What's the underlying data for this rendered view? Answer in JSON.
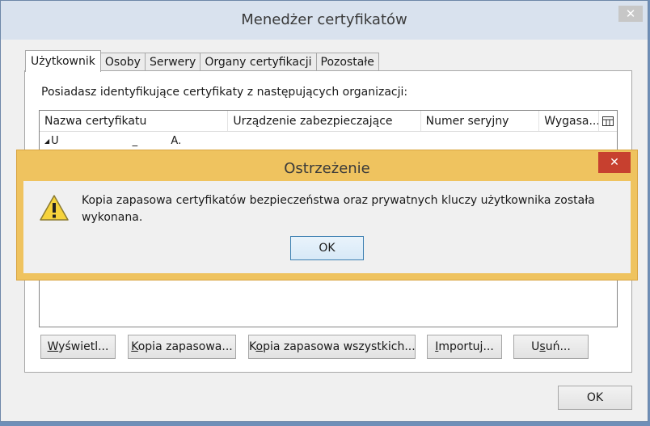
{
  "window": {
    "title": "Menedżer certyfikatów",
    "close_glyph": "✕"
  },
  "tabs": [
    {
      "label": "Użytkownik",
      "active": true
    },
    {
      "label": "Osoby",
      "active": false
    },
    {
      "label": "Serwery",
      "active": false
    },
    {
      "label": "Organy certyfikacji",
      "active": false
    },
    {
      "label": "Pozostałe",
      "active": false
    }
  ],
  "panel": {
    "description": "Posiadasz identyfikujące certyfikaty z następujących organizacji:"
  },
  "table": {
    "columns": [
      "Nazwa certyfikatu",
      "Urządzenie zabezpieczające",
      "Numer seryjny",
      "Wygasa..."
    ],
    "rows": [
      {
        "name": "U                      _          A."
      }
    ]
  },
  "buttons": {
    "view": {
      "key": "W",
      "rest": "yświetl..."
    },
    "backup": {
      "key": "K",
      "rest": "opia zapasowa..."
    },
    "backup_all_pre": "K",
    "backup_all_key": "o",
    "backup_all_rest": "pia zapasowa wszystkich...",
    "import": {
      "key": "I",
      "rest": "mportuj..."
    },
    "delete_pre": "U",
    "delete_key": "s",
    "delete_rest": "uń...",
    "ok": "OK"
  },
  "alert": {
    "title": "Ostrzeżenie",
    "close_glyph": "✕",
    "message": "Kopia zapasowa certyfikatów bezpieczeństwa oraz prywatnych kluczy użytkownika została wykonana.",
    "ok": "OK"
  },
  "colors": {
    "alert_frame": "#efc35f",
    "alert_close": "#c7402f",
    "window_title_bg": "#d9e2ee"
  }
}
